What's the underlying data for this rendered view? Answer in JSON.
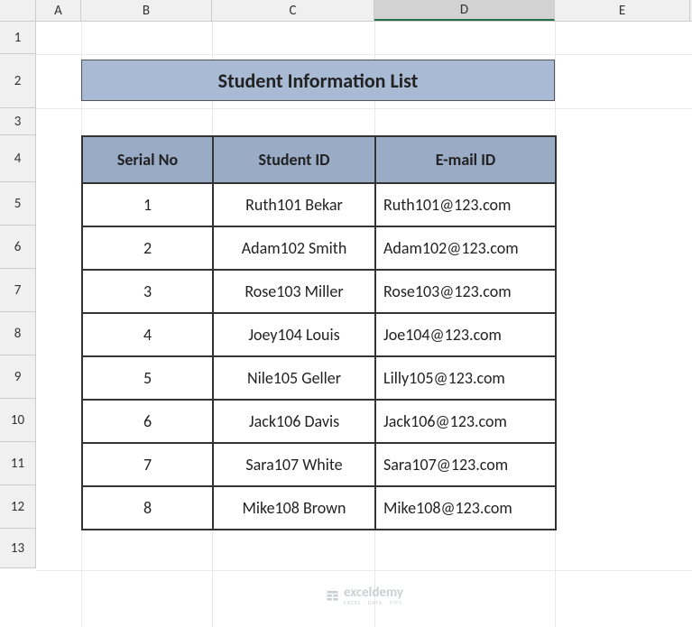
{
  "columns": [
    "A",
    "B",
    "C",
    "D",
    "E"
  ],
  "rows": [
    "1",
    "2",
    "3",
    "4",
    "5",
    "6",
    "7",
    "8",
    "9",
    "10",
    "11",
    "12",
    "13"
  ],
  "selected_column": "D",
  "title": "Student Information List",
  "headers": {
    "serial": "Serial No",
    "student_id": "Student ID",
    "email": "E-mail ID"
  },
  "chart_data": {
    "type": "table",
    "title": "Student Information List",
    "columns": [
      "Serial No",
      "Student ID",
      "E-mail ID"
    ],
    "rows": [
      {
        "serial": "1",
        "student_id": "Ruth101 Bekar",
        "email": "Ruth101@123.com"
      },
      {
        "serial": "2",
        "student_id": "Adam102 Smith",
        "email": "Adam102@123.com"
      },
      {
        "serial": "3",
        "student_id": "Rose103 Miller",
        "email": "Rose103@123.com"
      },
      {
        "serial": "4",
        "student_id": "Joey104 Louis",
        "email": "Joe104@123.com"
      },
      {
        "serial": "5",
        "student_id": "Nile105 Geller",
        "email": "Lilly105@123.com"
      },
      {
        "serial": "6",
        "student_id": "Jack106 Davis",
        "email": "Jack106@123.com"
      },
      {
        "serial": "7",
        "student_id": "Sara107 White",
        "email": "Sara107@123.com"
      },
      {
        "serial": "8",
        "student_id": "Mike108 Brown",
        "email": "Mike108@123.com"
      }
    ]
  },
  "watermark": {
    "brand": "exceldemy",
    "tagline": "EXCEL · DATA · TIPS"
  }
}
